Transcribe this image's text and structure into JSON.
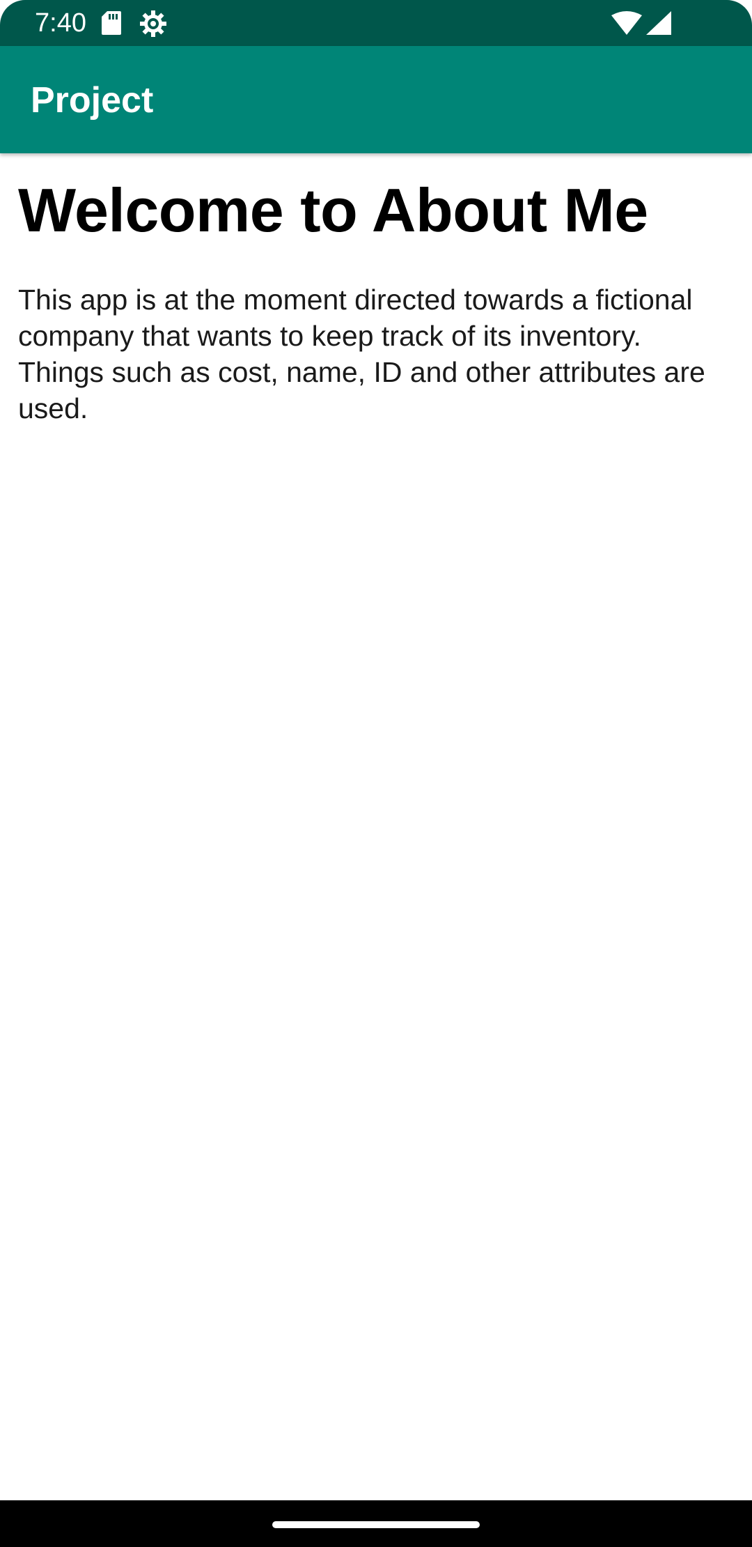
{
  "status_bar": {
    "time": "7:40",
    "icons": [
      "sd-card-icon",
      "gear-icon",
      "wifi-icon",
      "signal-icon"
    ],
    "color": "#00574b"
  },
  "app_bar": {
    "title": "Project",
    "color": "#008577"
  },
  "content": {
    "heading": "Welcome to About Me",
    "body": "This app is at the moment directed towards a fictional company that wants to keep track of its inventory. Things such as cost, name, ID and other attributes are used."
  },
  "nav_bar": {
    "handle": "home-handle"
  }
}
